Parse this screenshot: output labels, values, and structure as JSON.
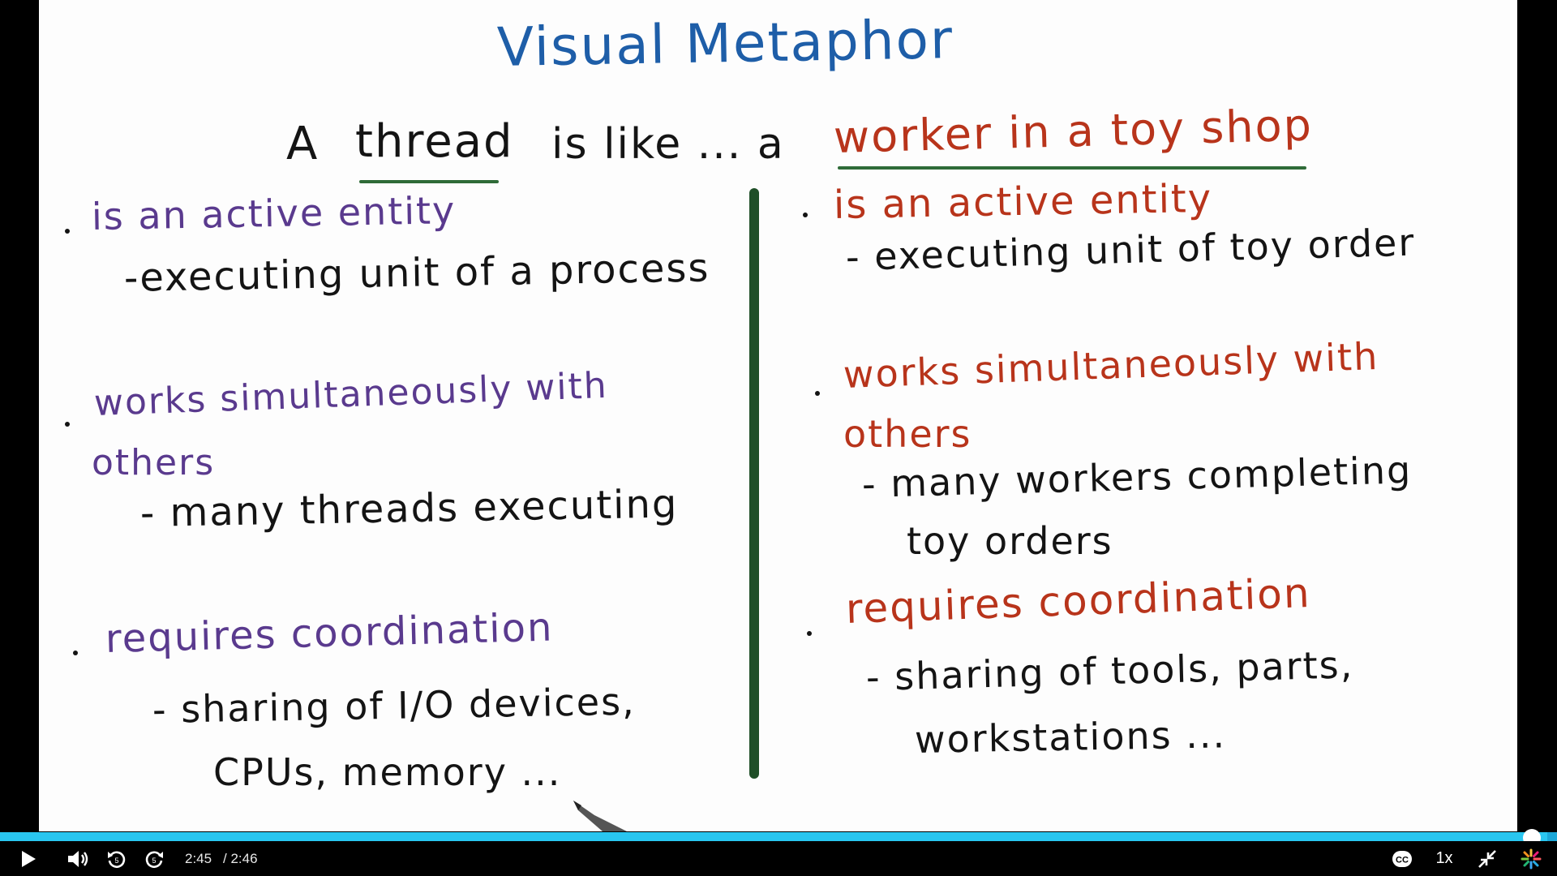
{
  "slide": {
    "title": "Visual Metaphor",
    "heading_prefix": "A",
    "heading_thread": "thread",
    "heading_middle": "is like ... a",
    "heading_worker": "worker in a toy shop",
    "left": [
      {
        "point": "is an active entity",
        "detail": [
          "-executing unit of a process"
        ]
      },
      {
        "point": "works simultaneously with",
        "point2": "others",
        "detail": [
          "- many threads executing"
        ]
      },
      {
        "point": "requires coordination",
        "detail": [
          "- sharing of I/O devices,",
          "CPUs, memory ..."
        ]
      }
    ],
    "right": [
      {
        "point": "is an active entity",
        "detail": [
          "- executing unit of toy order"
        ]
      },
      {
        "point": "works simultaneously with",
        "point2": "others",
        "detail": [
          "- many workers completing",
          "toy orders"
        ]
      },
      {
        "point": "requires coordination",
        "detail": [
          "- sharing of tools, parts,",
          "workstations ..."
        ]
      }
    ]
  },
  "player": {
    "current_time": "2:45",
    "duration": "/ 2:46",
    "progress": 0.994,
    "speed": "1x"
  },
  "colors": {
    "title": "#1e5ea8",
    "left_points": "#5a3a8e",
    "right_points": "#b8341b",
    "divider": "#1f4f28",
    "progress": "#1ba7d8"
  },
  "icons": [
    "play-icon",
    "volume-icon",
    "rewind-icon",
    "forward-icon",
    "captions-icon",
    "exit-fullscreen-icon",
    "brand-logo-icon"
  ]
}
